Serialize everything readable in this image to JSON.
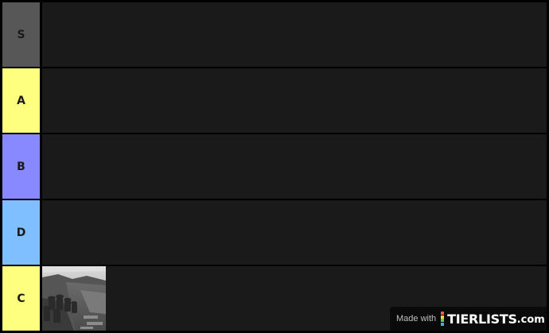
{
  "tiers": [
    {
      "label": "S",
      "color": "#575757",
      "items": []
    },
    {
      "label": "A",
      "color": "#ffff7f",
      "items": []
    },
    {
      "label": "B",
      "color": "#8888ff",
      "items": []
    },
    {
      "label": "D",
      "color": "#80bfff",
      "items": []
    },
    {
      "label": "C",
      "color": "#ffff7f",
      "items": [
        {
          "icon": "trench-soldiers-photo"
        }
      ]
    }
  ],
  "watermark": {
    "made_with": "Made with",
    "brand": "TIERLISTS",
    "tld": ".com",
    "logo_colors": [
      "#ff5a5a",
      "#ffd24d",
      "#5ad15a",
      "#4da6ff"
    ]
  },
  "colors": {
    "background": "#000000",
    "row_content": "#1a1a1a",
    "watermark_bg": "#0a0a0a"
  }
}
